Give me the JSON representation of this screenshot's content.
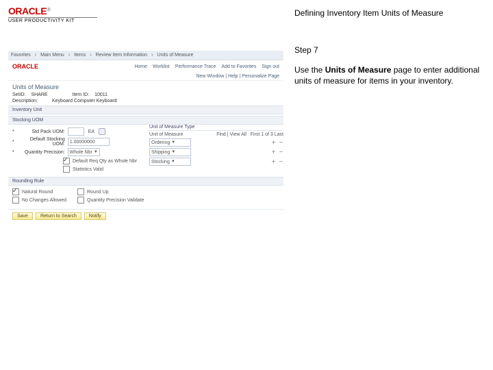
{
  "logo": {
    "brand": "ORACLE",
    "tm": "®",
    "sub": "USER PRODUCTIVITY KIT"
  },
  "right": {
    "title": "Defining Inventory Item Units of Measure",
    "step": "Step 7",
    "body_pre": "Use the ",
    "body_bold": "Units of Measure",
    "body_post": " page to enter additional units of measure for items in your inventory."
  },
  "ss": {
    "tabs": [
      "Favorites",
      "Main Menu",
      "Items",
      "Review Item Information",
      "Units of Measure"
    ],
    "brand": "ORACLE",
    "toplinks": [
      "Home",
      "Worklist",
      "Performance Trace",
      "Add to Favorites",
      "Sign out"
    ],
    "breadcrumb": "New Window | Help | Personalize Page",
    "page_title": "Units of Measure",
    "kv1_label": "SetID:",
    "kv1_val": "SHARE",
    "kv2_label": "Item ID:",
    "kv2_val": "10011",
    "kv3_label": "Description:",
    "kv3_val": "Keyboard Computer Keyboard",
    "unit_hdr": "Inventory Unit",
    "stock_hdr": "Stocking UOM",
    "f_std_label": "Std Pack UOM:",
    "f_std_ph": "EA",
    "f_def_label": "Default Stocking UOM:",
    "f_def_val": "1.00000000",
    "f_qty_label": "Quantity Precision:",
    "f_qty_val": "Whole Nbr",
    "chk_round": "Default Req Qty as Whole Nbr",
    "chk_stat": "Statistics Valid",
    "uomtype_hdr": "Unit of Measure Type",
    "uom_col": "Unit of Measure",
    "find": "Find | View All",
    "pager": "First 1 of 3 Last",
    "uom1": "Ordering",
    "uom2": "Shipping",
    "uom3": "Stocking",
    "rounding_hdr": "Rounding Rule",
    "r1": "Natural Round",
    "r2": "Round Up",
    "r3": "No Changes Allowed",
    "r4": "Quantity Precision Validate",
    "btn_save": "Save",
    "btn_return": "Return to Search",
    "btn_notify": "Notify"
  }
}
